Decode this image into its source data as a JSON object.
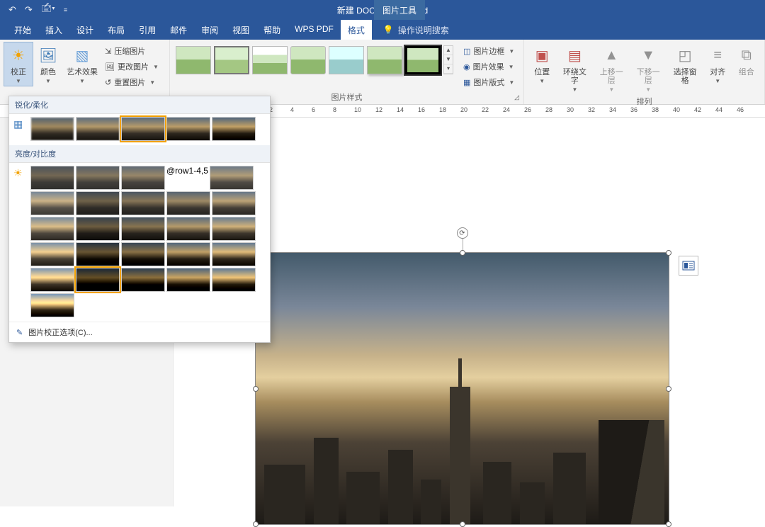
{
  "titlebar": {
    "title": "新建 DOCX 文档  -  Word",
    "contextual_tab": "图片工具"
  },
  "tabs": {
    "items": [
      "开始",
      "插入",
      "设计",
      "布局",
      "引用",
      "邮件",
      "审阅",
      "视图",
      "帮助",
      "WPS PDF",
      "格式"
    ],
    "active_index": 10,
    "tell_me": "操作说明搜索"
  },
  "ribbon": {
    "adjust": {
      "corrections": "校正",
      "color": "颜色",
      "artistic": "艺术效果",
      "compress": "压缩图片",
      "change": "更改图片",
      "reset": "重置图片"
    },
    "styles": {
      "group_label": "图片样式",
      "border": "图片边框",
      "effects": "图片效果",
      "layout": "图片版式"
    },
    "arrange": {
      "group_label": "排列",
      "position": "位置",
      "wrap": "环绕文字",
      "bring_fwd": "上移一层",
      "send_back": "下移一层",
      "selection_pane": "选择窗格",
      "align": "对齐",
      "group": "组合"
    }
  },
  "dropdown": {
    "section_sharpen": "锐化/柔化",
    "section_brightness": "亮度/对比度",
    "options": "图片校正选项(C)..."
  },
  "ruler": {
    "start": 40,
    "end": 46,
    "step": 2,
    "visible": [
      2,
      4,
      6,
      8,
      10,
      12,
      14,
      16,
      18,
      20,
      22,
      24,
      26,
      28,
      30,
      32,
      34,
      36,
      38,
      40,
      42,
      44,
      46
    ]
  }
}
